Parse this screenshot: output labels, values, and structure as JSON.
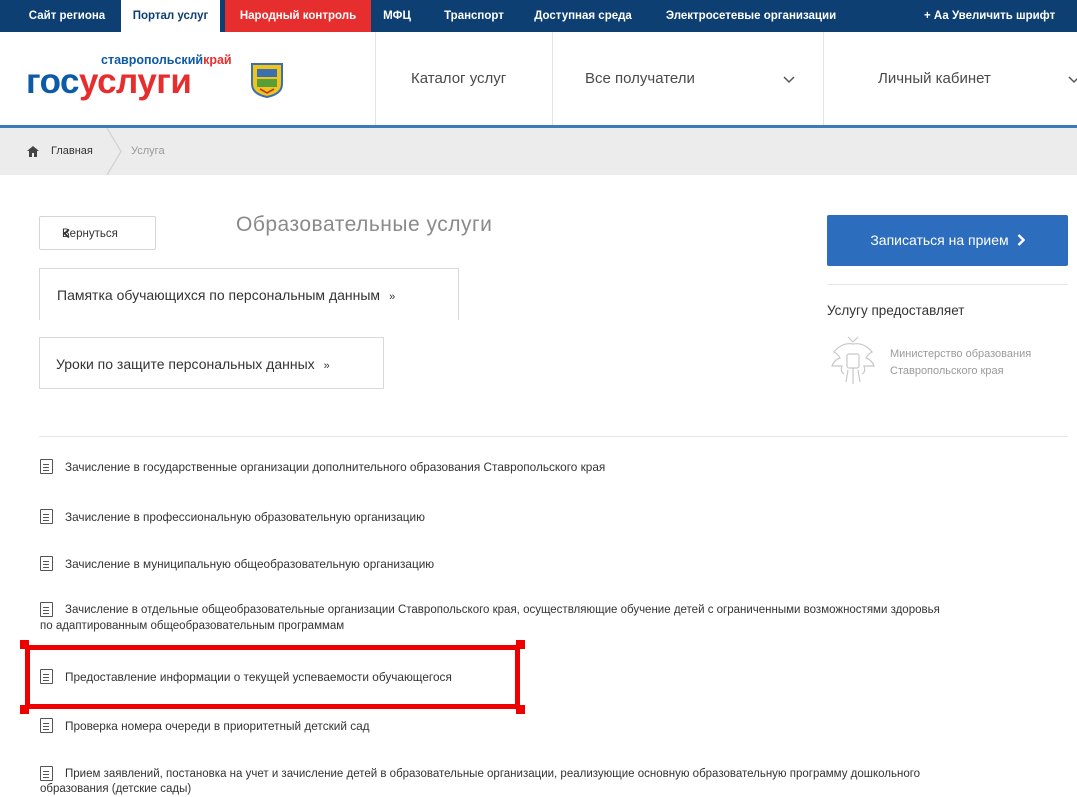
{
  "topbar": {
    "tabs": [
      "Сайт региона",
      "Портал услуг",
      "Народный контроль",
      "МФЦ",
      "Транспорт",
      "Доступная среда",
      "Электросетевые организации"
    ],
    "font_label": "+ Аа Увеличить шрифт"
  },
  "logo": {
    "region_main": "ставропольский",
    "region_accent": "край",
    "wordmark_left": "гос",
    "wordmark_right": "услуги"
  },
  "nav": {
    "catalog": "Каталог услуг",
    "recipients": "Все получатели",
    "cabinet": "Личный кабинет"
  },
  "breadcrumb": {
    "home": "Главная",
    "current": "Услуга"
  },
  "page": {
    "back": "Вернуться",
    "title": "Образовательные услуги"
  },
  "info_links": [
    "Памятка обучающихся по персональным данным",
    "Уроки по защите персональных данных"
  ],
  "sidebar": {
    "appointment": "Записаться на прием",
    "provider_label": "Услугу предоставляет",
    "ministry_line1": "Министерство образования",
    "ministry_line2": "Ставропольского края"
  },
  "services": [
    {
      "line1": "Зачисление в государственные организации дополнительного образования Ставропольского края",
      "line2": ""
    },
    {
      "line1": "Зачисление в профессиональную образовательную организацию",
      "line2": ""
    },
    {
      "line1": "Зачисление в муниципальную общеобразовательную организацию",
      "line2": ""
    },
    {
      "line1": "Зачисление в отдельные общеобразовательные организации Ставропольского края, осуществляющие обучение детей с ограниченными возможностями здоровья",
      "line2": "по адаптированным общеобразовательным программам"
    },
    {
      "line1": "Предоставление информации о текущей успеваемости обучающегося",
      "line2": ""
    },
    {
      "line1": "Проверка номера очереди в приоритетный детский сад",
      "line2": ""
    },
    {
      "line1": "Прием заявлений, постановка на учет и зачисление детей в образовательные организации, реализующие основную образовательную программу дошкольного",
      "line2": "образования (детские сады)"
    }
  ],
  "colors": {
    "topbar": "#0d3f72",
    "accent_red": "#e62e2e",
    "button_blue": "#2d6dbd",
    "highlight": "#ee0000"
  }
}
